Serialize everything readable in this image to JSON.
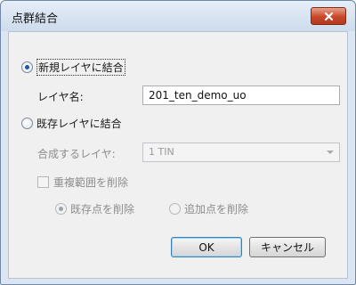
{
  "window": {
    "title": "点群結合"
  },
  "options": {
    "new_layer_label": "新規レイヤに結合",
    "layer_name_label": "レイヤ名:",
    "layer_name_value": "201_ten_demo_uo",
    "existing_layer_label": "既存レイヤに結合",
    "merge_layer_label": "合成するレイヤ:",
    "merge_layer_value": "1 TIN",
    "delete_overlap_label": "重複範囲を削除",
    "delete_existing_points_label": "既存点を削除",
    "delete_added_points_label": "追加点を削除"
  },
  "buttons": {
    "ok": "OK",
    "cancel": "キャンセル"
  },
  "icons": {
    "close": "close-icon",
    "dropdown": "chevron-down-icon"
  },
  "colors": {
    "close_button": "#c8472a",
    "selected_radio": "#1c58a8"
  }
}
